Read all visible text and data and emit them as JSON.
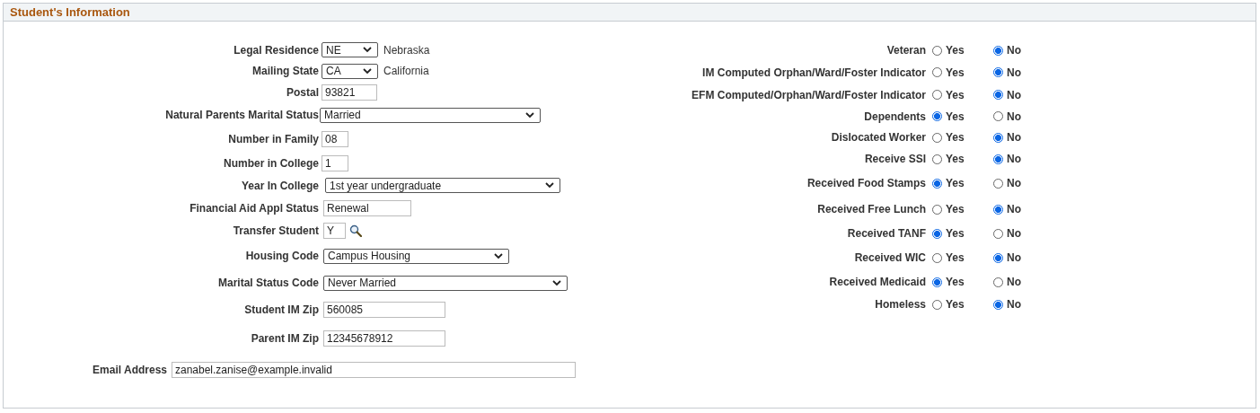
{
  "panel": {
    "title": "Student's Information"
  },
  "fields": [
    {
      "label": "Legal Residence",
      "kind": "select",
      "value": "NE",
      "note": "Nebraska"
    },
    {
      "label": "Mailing State",
      "kind": "select",
      "value": "CA",
      "note": "California"
    },
    {
      "label": "Postal",
      "kind": "text",
      "value": "93821"
    },
    {
      "label": "Natural Parents Marital Status",
      "kind": "select",
      "value": "Married"
    },
    {
      "label": "Number in Family",
      "kind": "text",
      "value": "08"
    },
    {
      "label": "Number in College",
      "kind": "text",
      "value": "1"
    },
    {
      "label": "Year In College",
      "kind": "select",
      "value": "1st year undergraduate"
    },
    {
      "label": "Financial Aid Appl Status",
      "kind": "text",
      "value": "Renewal"
    },
    {
      "label": "Transfer Student",
      "kind": "lookup",
      "value": "Y"
    },
    {
      "label": "Housing Code",
      "kind": "select",
      "value": "Campus Housing"
    },
    {
      "label": "Marital Status Code",
      "kind": "select",
      "value": "Never Married"
    },
    {
      "label": "Student IM Zip",
      "kind": "text",
      "value": "560085"
    },
    {
      "label": "Parent IM Zip",
      "kind": "text",
      "value": "12345678912"
    },
    {
      "label": "Email Address",
      "kind": "text",
      "value": "zanabel.zanise@example.invalid"
    }
  ],
  "indicators": [
    {
      "label": "Veteran",
      "options": [
        {
          "label": "Yes",
          "selected": false
        },
        {
          "label": "No",
          "selected": true
        }
      ]
    },
    {
      "label": "IM Computed Orphan/Ward/Foster Indicator",
      "options": [
        {
          "label": "Yes",
          "selected": false
        },
        {
          "label": "No",
          "selected": true
        }
      ]
    },
    {
      "label": "EFM Computed/Orphan/Ward/Foster Indicator",
      "options": [
        {
          "label": "Yes",
          "selected": false
        },
        {
          "label": "No",
          "selected": true
        }
      ]
    },
    {
      "label": "Dependents",
      "options": [
        {
          "label": "Yes",
          "selected": true
        },
        {
          "label": "No",
          "selected": false
        }
      ]
    },
    {
      "label": "Dislocated Worker",
      "options": [
        {
          "label": "Yes",
          "selected": false
        },
        {
          "label": "No",
          "selected": true
        }
      ]
    },
    {
      "label": "Receive SSI",
      "options": [
        {
          "label": "Yes",
          "selected": false
        },
        {
          "label": "No",
          "selected": true
        }
      ]
    },
    {
      "label": "Received Food Stamps",
      "options": [
        {
          "label": "Yes",
          "selected": true
        },
        {
          "label": "No",
          "selected": false
        }
      ]
    },
    {
      "label": "Received Free Lunch",
      "options": [
        {
          "label": "Yes",
          "selected": false
        },
        {
          "label": "No",
          "selected": true
        }
      ]
    },
    {
      "label": "Received TANF",
      "options": [
        {
          "label": "Yes",
          "selected": true
        },
        {
          "label": "No",
          "selected": false
        }
      ]
    },
    {
      "label": "Received WIC",
      "options": [
        {
          "label": "Yes",
          "selected": false
        },
        {
          "label": "No",
          "selected": true
        }
      ]
    },
    {
      "label": "Received Medicaid",
      "options": [
        {
          "label": "Yes",
          "selected": true
        },
        {
          "label": "No",
          "selected": false
        }
      ]
    },
    {
      "label": "Homeless",
      "options": [
        {
          "label": "Yes",
          "selected": false
        },
        {
          "label": "No",
          "selected": true
        }
      ]
    }
  ]
}
